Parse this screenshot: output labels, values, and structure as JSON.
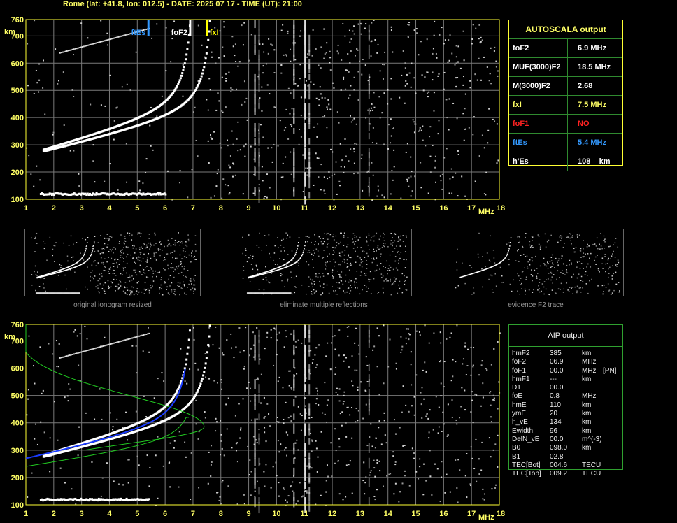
{
  "header": {
    "title": "Rome (lat: +41.8, lon: 012.5) - DATE: 2025 07 17 - TIME (UT): 21:00"
  },
  "ionogram": {
    "freq_ticks": [
      "1",
      "2",
      "3",
      "4",
      "5",
      "6",
      "7",
      "8",
      "9",
      "10",
      "11",
      "12",
      "13",
      "14",
      "15",
      "16",
      "17",
      "18"
    ],
    "height_ticks": [
      "760",
      "700",
      "600",
      "500",
      "400",
      "300",
      "200",
      "100"
    ],
    "km_label": "km",
    "mhz_label": "MHz",
    "markers": {
      "ftEs": "ftEs",
      "foF2": "foF2",
      "fxI": "fxI"
    }
  },
  "autoscala": {
    "title": "AUTOSCALA output",
    "rows": [
      {
        "k": "foF2",
        "v": "6.9 MHz",
        "kc": "#ffffff",
        "vc": "#ffffff"
      },
      {
        "k": "MUF(3000)F2",
        "v": "18.5 MHz",
        "kc": "#ffffff",
        "vc": "#ffffff"
      },
      {
        "k": "M(3000)F2",
        "v": "2.68",
        "kc": "#ffffff",
        "vc": "#ffffff"
      },
      {
        "k": "fxI",
        "v": "7.5 MHz",
        "kc": "#ffff66",
        "vc": "#ffff66"
      },
      {
        "k": "foF1",
        "v": "NO",
        "kc": "#ff2222",
        "vc": "#ff2222"
      },
      {
        "k": "ftEs",
        "v": "5.4 MHz",
        "kc": "#3399ff",
        "vc": "#3399ff"
      },
      {
        "k": "h'Es",
        "v": "108    km",
        "kc": "#ffffff",
        "vc": "#ffffff"
      }
    ]
  },
  "thumbnails": [
    {
      "label": "original ionogram resized"
    },
    {
      "label": "eliminate multiple reflections"
    },
    {
      "label": "evidence F2 trace"
    }
  ],
  "aip": {
    "title": "AIP output",
    "rows": [
      {
        "k": "hmF2",
        "v": "385",
        "u": "km",
        "x": ""
      },
      {
        "k": "foF2",
        "v": "06.9",
        "u": "MHz",
        "x": ""
      },
      {
        "k": "foF1",
        "v": "00.0",
        "u": "MHz",
        "x": "[PN]"
      },
      {
        "k": "hmF1",
        "v": "---",
        "u": "km",
        "x": ""
      },
      {
        "k": "D1",
        "v": "00.0",
        "u": "",
        "x": ""
      },
      {
        "k": "foE",
        "v": "0.8",
        "u": "MHz",
        "x": ""
      },
      {
        "k": "hmE",
        "v": "110",
        "u": "km",
        "x": ""
      },
      {
        "k": "ymE",
        "v": "20",
        "u": "km",
        "x": ""
      },
      {
        "k": "h_vE",
        "v": "134",
        "u": "km",
        "x": ""
      },
      {
        "k": "Ewidth",
        "v": "96",
        "u": "km",
        "x": ""
      },
      {
        "k": "DelN_vE",
        "v": "00.0",
        "u": "m^(-3)",
        "x": ""
      },
      {
        "k": "B0",
        "v": "098.0",
        "u": "km",
        "x": ""
      },
      {
        "k": "B1",
        "v": "02.8",
        "u": "",
        "x": ""
      },
      {
        "k": "TEC[Bot]",
        "v": "004.6",
        "u": "TECU",
        "x": ""
      },
      {
        "k": "TEC[Top]",
        "v": "009.2",
        "u": "TECU",
        "x": ""
      }
    ]
  },
  "colors": {
    "axis": "#ffff33",
    "grid": "#7a7a7a",
    "trace": "#ffffff",
    "ftEs": "#3399ff",
    "fxI": "#ffff00",
    "profile": "#22cc22",
    "fit": "#1a3cff"
  }
}
